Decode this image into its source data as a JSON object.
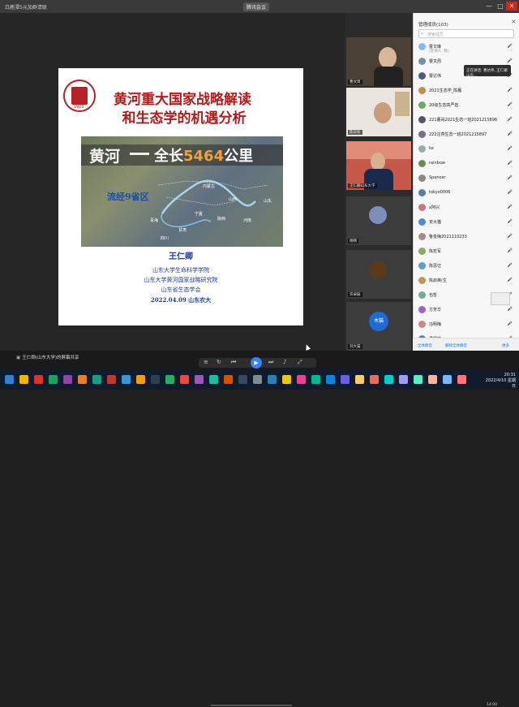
{
  "window": {
    "left_title": "白鹿潭5元加群请联",
    "center_title": "腾讯会议",
    "controls": [
      "—",
      "□",
      "✕"
    ]
  },
  "slide": {
    "logo_year": "1901",
    "title_line1": "黄河重大国家战略解读",
    "title_line2": "和生态学的机遇分析",
    "map_banner_left": "黄河",
    "map_banner_prefix": "全长",
    "map_banner_number": "5464",
    "map_banner_suffix": "公里",
    "map_provinces": "流经9省区",
    "map_labels": [
      "甘肃",
      "宁夏",
      "内蒙古",
      "陕西",
      "山西",
      "河南",
      "山东",
      "青海",
      "四川"
    ],
    "presenter": "王仁卿",
    "affiliations": [
      "山东大学生命科学学院",
      "山东大学黄河国家战略研究院",
      "山东省生态学会",
      "2022.04.09  山东农大"
    ]
  },
  "video_tiles": [
    {
      "name": "曹文周"
    },
    {
      "name": "陈日冬"
    },
    {
      "name": "王仁卿山东大学"
    },
    {
      "name": "杨晴"
    },
    {
      "name": "许卓辰"
    },
    {
      "name": "刘大猫",
      "avatar_text": "木猫"
    }
  ],
  "panel": {
    "title": "管理成员(103)",
    "search_placeholder": "搜索成员",
    "popup_text": "正在讲话: 曹达伟, 王仁卿山东...",
    "members": [
      {
        "name": "曹文琳",
        "sub": "(主持人, 我)",
        "color": "#8bbbe8"
      },
      {
        "name": "曹文周",
        "sub": "",
        "color": "#7a8fa6"
      },
      {
        "name": "曹达伟",
        "sub": "",
        "color": "#4a5d7e"
      },
      {
        "name": "2021生态学_陈雁",
        "sub": "",
        "color": "#c98a4a"
      },
      {
        "name": "20级生态高严岩",
        "sub": "",
        "color": "#6fa86f"
      },
      {
        "name": "221董哥2021生态一班2021215896",
        "sub": "",
        "color": "#556"
      },
      {
        "name": "222汪燕生态一班2021215897",
        "sub": "",
        "color": "#7b6a8f"
      },
      {
        "name": "hz",
        "sub": "",
        "color": "#9aa"
      },
      {
        "name": "rainbow",
        "sub": "",
        "color": "#6b8e4e"
      },
      {
        "name": "Spencer",
        "sub": "",
        "color": "#888"
      },
      {
        "name": "tokyo0006",
        "sub": "",
        "color": "#5a7da8"
      },
      {
        "name": "x阿兴",
        "sub": "",
        "color": "#c77"
      },
      {
        "name": "安大猫",
        "sub": "",
        "color": "#4a8fd0"
      },
      {
        "name": "鲁俊梅2021110233",
        "sub": "",
        "color": "#a88"
      },
      {
        "name": "陈宏军",
        "sub": "",
        "color": "#8a6"
      },
      {
        "name": "陈思亿",
        "sub": "",
        "color": "#69c"
      },
      {
        "name": "陈启英(生",
        "sub": "",
        "color": "#b95"
      },
      {
        "name": "也哲",
        "sub": "",
        "color": "#7a9"
      },
      {
        "name": "方芳华",
        "sub": "",
        "color": "#96b"
      },
      {
        "name": "冯明梅",
        "sub": "",
        "color": "#c88"
      },
      {
        "name": "董钢柏",
        "sub": "",
        "color": "#58a"
      }
    ],
    "footer_left": "全体静音",
    "footer_mid": "解除全体静音",
    "footer_right": "更多"
  },
  "share_bar": {
    "label": "王仁卿(山东大学)的屏幕共享",
    "time": "14:00"
  },
  "taskbar": {
    "time": "20:31",
    "date": "2022/4/10 星期日"
  },
  "colors": {
    "slide_title": "#b31b1b",
    "slide_blue": "#1d3ea8",
    "accent_orange": "#f2a23a",
    "taskbar_bg": "#101c2c"
  }
}
